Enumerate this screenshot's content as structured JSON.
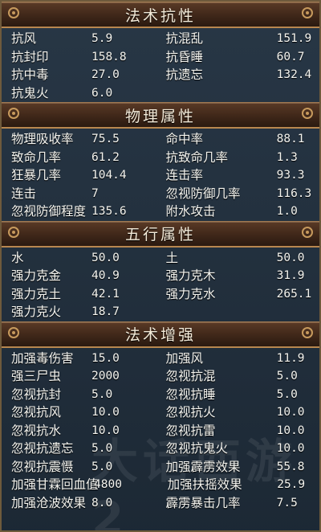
{
  "sections": [
    {
      "title": "法术抗性",
      "rows": [
        [
          "抗风",
          "5.9",
          "抗混乱",
          "151.9"
        ],
        [
          "抗封印",
          "158.8",
          "抗昏睡",
          "60.7"
        ],
        [
          "抗中毒",
          "27.0",
          "抗遗忘",
          "132.4"
        ],
        [
          "抗鬼火",
          "6.0",
          "",
          ""
        ]
      ]
    },
    {
      "title": "物理属性",
      "rows": [
        [
          "物理吸收率",
          "75.5",
          "命中率",
          "88.1"
        ],
        [
          "致命几率",
          "61.2",
          "抗致命几率",
          "1.3"
        ],
        [
          "狂暴几率",
          "104.4",
          "连击率",
          "93.3"
        ],
        [
          "连击",
          "7",
          "忽视防御几率",
          "116.3"
        ],
        [
          "忽视防御程度",
          "135.6",
          "附水攻击",
          "1.0"
        ]
      ]
    },
    {
      "title": "五行属性",
      "rows": [
        [
          "水",
          "50.0",
          "土",
          "50.0"
        ],
        [
          "强力克金",
          "40.9",
          "强力克木",
          "31.9"
        ],
        [
          "强力克土",
          "42.1",
          "强力克水",
          "265.1"
        ],
        [
          "强力克火",
          "18.7",
          "",
          ""
        ]
      ]
    },
    {
      "title": "法术增强",
      "rows": [
        [
          "加强毒伤害",
          "15.0",
          "加强风",
          "11.9"
        ],
        [
          "强三尸虫",
          "2000",
          "忽视抗混",
          "5.0"
        ],
        [
          "忽视抗封",
          "5.0",
          "忽视抗睡",
          "5.0"
        ],
        [
          "忽视抗风",
          "10.0",
          "忽视抗火",
          "10.0"
        ],
        [
          "忽视抗水",
          "10.0",
          "忽视抗雷",
          "10.0"
        ],
        [
          "忽视抗遗忘",
          "5.0",
          "忽视抗鬼火",
          "10.0"
        ],
        [
          "忽视抗震慑",
          "5.0",
          "加强霹雳效果",
          "55.8"
        ],
        [
          "加强甘霖回血值",
          "4800",
          "加强扶摇效果",
          "25.9"
        ],
        [
          "加强沧波效果",
          "8.0",
          "霹雳暴击几率",
          "7.5"
        ]
      ]
    }
  ]
}
